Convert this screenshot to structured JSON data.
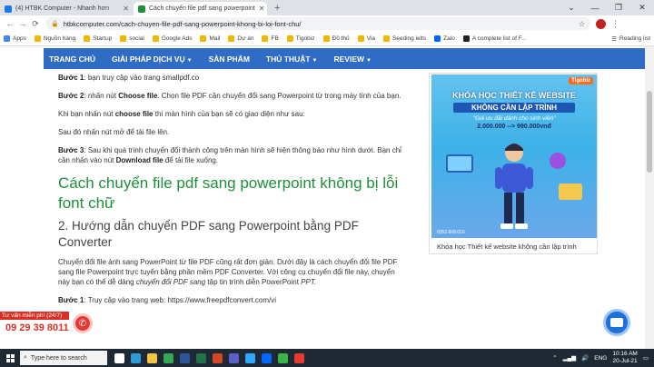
{
  "browser": {
    "tabs": [
      {
        "title": "(4) HTBK Computer - Nhanh hơn",
        "active": false,
        "favicon_color": "#1877f2"
      },
      {
        "title": "Cách chuyển file pdf sang powerpoint",
        "active": true,
        "favicon_color": "#1e8f3a"
      }
    ],
    "new_tab": "+",
    "url": "htbkcomputer.com/cach-chuyen-file-pdf-sang-powerpoint-khong-bi-loi-font-chu/",
    "bookmarks": [
      {
        "label": "Apps",
        "color": "#4285f4"
      },
      {
        "label": "Nguồn hàng",
        "color": "#f2b600"
      },
      {
        "label": "Startup",
        "color": "#f2b600"
      },
      {
        "label": "social",
        "color": "#f2b600"
      },
      {
        "label": "Google Ads",
        "color": "#f2b600"
      },
      {
        "label": "Mail",
        "color": "#f2b600"
      },
      {
        "label": "Dự án",
        "color": "#f2b600"
      },
      {
        "label": "FB",
        "color": "#f2b600"
      },
      {
        "label": "Tigobiz",
        "color": "#f2b600"
      },
      {
        "label": "Đồ thủ",
        "color": "#f2b600"
      },
      {
        "label": "Via",
        "color": "#f2b600"
      },
      {
        "label": "Seeding ielts",
        "color": "#f2b600"
      },
      {
        "label": "Zalo",
        "color": "#0068ff"
      },
      {
        "label": "A complete list of F...",
        "color": "#222"
      }
    ],
    "reading_list": "Reading list"
  },
  "site_nav": [
    "TRANG CHỦ",
    "GIẢI PHÁP DỊCH VỤ",
    "SẢN PHẨM",
    "THỦ THUẬT",
    "REVIEW"
  ],
  "article": {
    "step1_label": "Bước 1",
    "step1_text": ": bạn truy cập vào trang smallpdf.co",
    "step2_label": "Bước 2",
    "step2_pre": ": nhấn nút ",
    "step2_choose": "Choose file",
    "step2_post": ". Chọn file PDF cần chuyển đổi sang Powerpoint từ trong máy tính của bạn.",
    "p_click_pre": "Khi bạn nhấn nút ",
    "p_click_choose": "choose file",
    "p_click_post": " thì màn hình của bạn sẽ có giao diện như sau:",
    "p_open": "Sau đó nhấn nút mở để tải file lên.",
    "step3_label": "Bước 3",
    "step3_pre": ": Sau khi quá trình chuyển đổi thành công trên màn hình sẽ hiện thông báo như hình dưới. Bạn chỉ cần nhấn vào nút ",
    "step3_download": "Download file",
    "step3_post": " để tải file xuống.",
    "heading_green": "Cách chuyển file pdf sang powerpoint không bị lỗi font chữ",
    "heading_sub": "2. Hướng dẫn chuyển PDF sang Powerpoint bằng PDF Converter",
    "p_intro_pre": "Chuyển đổi file ảnh sang PowerPoint từ file PDF cũng rất đơn giản. Dưới đây là cách chuyển đổi file PDF sang file Powerpoint trực tuyến bằng phần mềm PDF Converter. Với công cụ chuyển đổi file này, chuyển này bạn có thể dễ dàng ",
    "p_intro_em": "chuyển đổi PDF sang",
    "p_intro_post": " tập tin trình diễn PowerPoint ",
    "p_intro_ppt": "PPT.",
    "step1b_label": "Bước 1",
    "step1b_text": ": Truy cập vào trang web: https://www.freepdfconvert.com/vi"
  },
  "sidebar": {
    "ad_brand": "Tigobiz",
    "ad_line1": "KHÓA HỌC THIẾT KẾ WEBSITE",
    "ad_line2": "KHÔNG CẦN LẬP TRÌNH",
    "ad_line3": "\"Giá ưu đãi dành cho sinh viên\"",
    "ad_line4": "2.000.000 --> 990.000vnđ",
    "ad_phone": "0352.668.010",
    "caption": "Khóa học Thiết kế website không cần lập trình"
  },
  "hotline": {
    "label": "Tư vấn miễn phí (24/7)",
    "number": "09 29 39 8011"
  },
  "taskbar": {
    "search_placeholder": "Type here to search",
    "icons": [
      {
        "name": "task-view-icon",
        "color": "#ffffff"
      },
      {
        "name": "edge-icon",
        "color": "#2f9bd6"
      },
      {
        "name": "file-explorer-icon",
        "color": "#f4c542"
      },
      {
        "name": "chrome-icon",
        "color": "#34a853"
      },
      {
        "name": "word-icon",
        "color": "#2b579a"
      },
      {
        "name": "excel-icon",
        "color": "#217346"
      },
      {
        "name": "powerpoint-icon",
        "color": "#d24726"
      },
      {
        "name": "teams-icon",
        "color": "#5b5fc7"
      },
      {
        "name": "photoshop-icon",
        "color": "#31a8ff"
      },
      {
        "name": "zalo-icon",
        "color": "#0068ff"
      },
      {
        "name": "camtasia-icon",
        "color": "#3bb54a"
      },
      {
        "name": "app-icon",
        "color": "#e63b2e"
      }
    ],
    "lang": "ENG",
    "time": "10:16 AM",
    "date": "20-Jul-21"
  }
}
